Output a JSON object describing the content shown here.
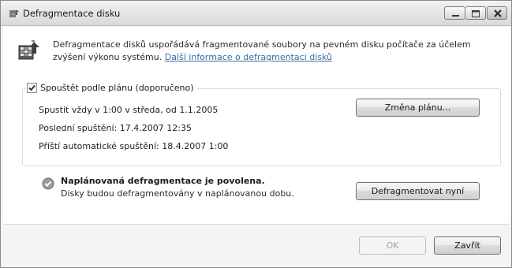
{
  "window": {
    "title": "Defragmentace disku",
    "icon": "defrag-app-icon"
  },
  "caption_buttons": {
    "minimize_icon": "minimize-icon",
    "maximize_icon": "maximize-icon",
    "close_icon": "close-icon"
  },
  "header": {
    "icon": "defrag-disk-icon",
    "description": "Defragmentace disků uspořádává fragmentované soubory na pevném disku počítače za účelem zvýšení výkonu systému.",
    "link_text": "Další informace o defragmentaci disků"
  },
  "schedule": {
    "checkbox_label": "Spouštět podle plánu (doporučeno)",
    "checked": true,
    "run_line": "Spustit vždy v 1:00 v středa, od 1.1.2005",
    "last_run": "Poslední spuštění: 17.4.2007 12:35",
    "next_run": "Příští automatické spuštění: 18.4.2007 1:00",
    "change_button": "Změna plánu..."
  },
  "status": {
    "icon": "check-circle-icon",
    "title": "Naplánovaná defragmentace je povolena.",
    "text": "Disky budou defragmentovány v naplánovanou dobu.",
    "defrag_button": "Defragmentovat nyní"
  },
  "footer": {
    "ok_button": "OK",
    "close_button": "Zavřít"
  }
}
